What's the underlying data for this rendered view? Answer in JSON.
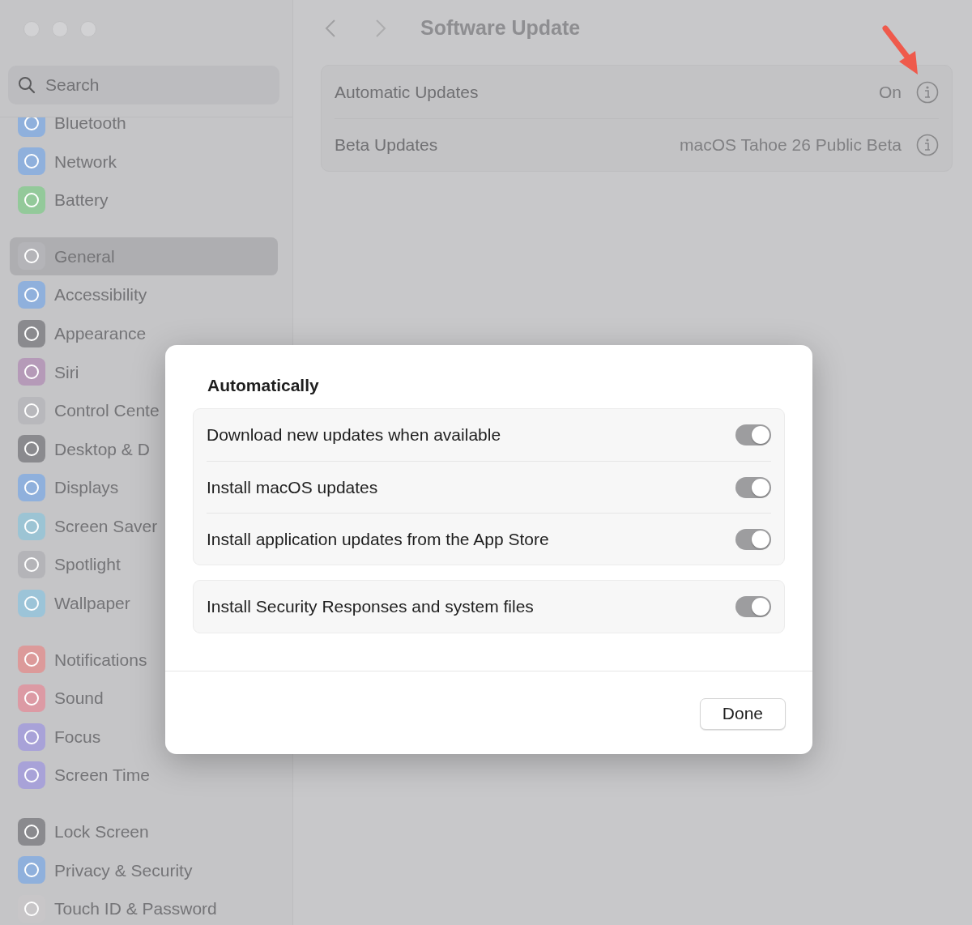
{
  "window": {
    "title": "Software Update"
  },
  "search": {
    "placeholder": "Search"
  },
  "sidebar": {
    "groups": [
      {
        "items": [
          {
            "label": "Bluetooth",
            "color": "#8fb0dc",
            "selected": false
          },
          {
            "label": "Network",
            "color": "#8fb0dc",
            "selected": false
          },
          {
            "label": "Battery",
            "color": "#93c99a",
            "selected": false
          }
        ]
      },
      {
        "items": [
          {
            "label": "General",
            "color": "#b4b4b8",
            "selected": true
          },
          {
            "label": "Accessibility",
            "color": "#8fb0dc",
            "selected": false
          },
          {
            "label": "Appearance",
            "color": "#8a8a8e",
            "selected": false
          },
          {
            "label": "Siri",
            "color": "#b59ab8",
            "selected": false
          },
          {
            "label": "Control Cente",
            "color": "#b8b8bc",
            "selected": false
          },
          {
            "label": "Desktop & D",
            "color": "#8a8a8e",
            "selected": false
          },
          {
            "label": "Displays",
            "color": "#8fb0dc",
            "selected": false
          },
          {
            "label": "Screen Saver",
            "color": "#9cc4d4",
            "selected": false
          },
          {
            "label": "Spotlight",
            "color": "#b4b4b8",
            "selected": false
          },
          {
            "label": "Wallpaper",
            "color": "#9cc4d8",
            "selected": false
          }
        ]
      },
      {
        "items": [
          {
            "label": "Notifications",
            "color": "#dc9a9a",
            "selected": false
          },
          {
            "label": "Sound",
            "color": "#dc9aa4",
            "selected": false
          },
          {
            "label": "Focus",
            "color": "#a8a2d8",
            "selected": false
          },
          {
            "label": "Screen Time",
            "color": "#a8a2d8",
            "selected": false
          }
        ]
      },
      {
        "items": [
          {
            "label": "Lock Screen",
            "color": "#8a8a8e",
            "selected": false
          },
          {
            "label": "Privacy & Security",
            "color": "#8fb0dc",
            "selected": false
          },
          {
            "label": "Touch ID & Password",
            "color": "#c8c6c8",
            "selected": false
          }
        ]
      }
    ]
  },
  "settings": [
    {
      "label": "Automatic Updates",
      "value": "On"
    },
    {
      "label": "Beta Updates",
      "value": "macOS Tahoe 26 Public Beta"
    }
  ],
  "dialog": {
    "title": "Automatically",
    "sections": [
      {
        "rows": [
          {
            "label": "Download new updates when available",
            "on": true
          },
          {
            "label": "Install macOS updates",
            "on": true
          },
          {
            "label": "Install application updates from the App Store",
            "on": true
          }
        ]
      },
      {
        "rows": [
          {
            "label": "Install Security Responses and system files",
            "on": true
          }
        ]
      }
    ],
    "button": "Done"
  }
}
